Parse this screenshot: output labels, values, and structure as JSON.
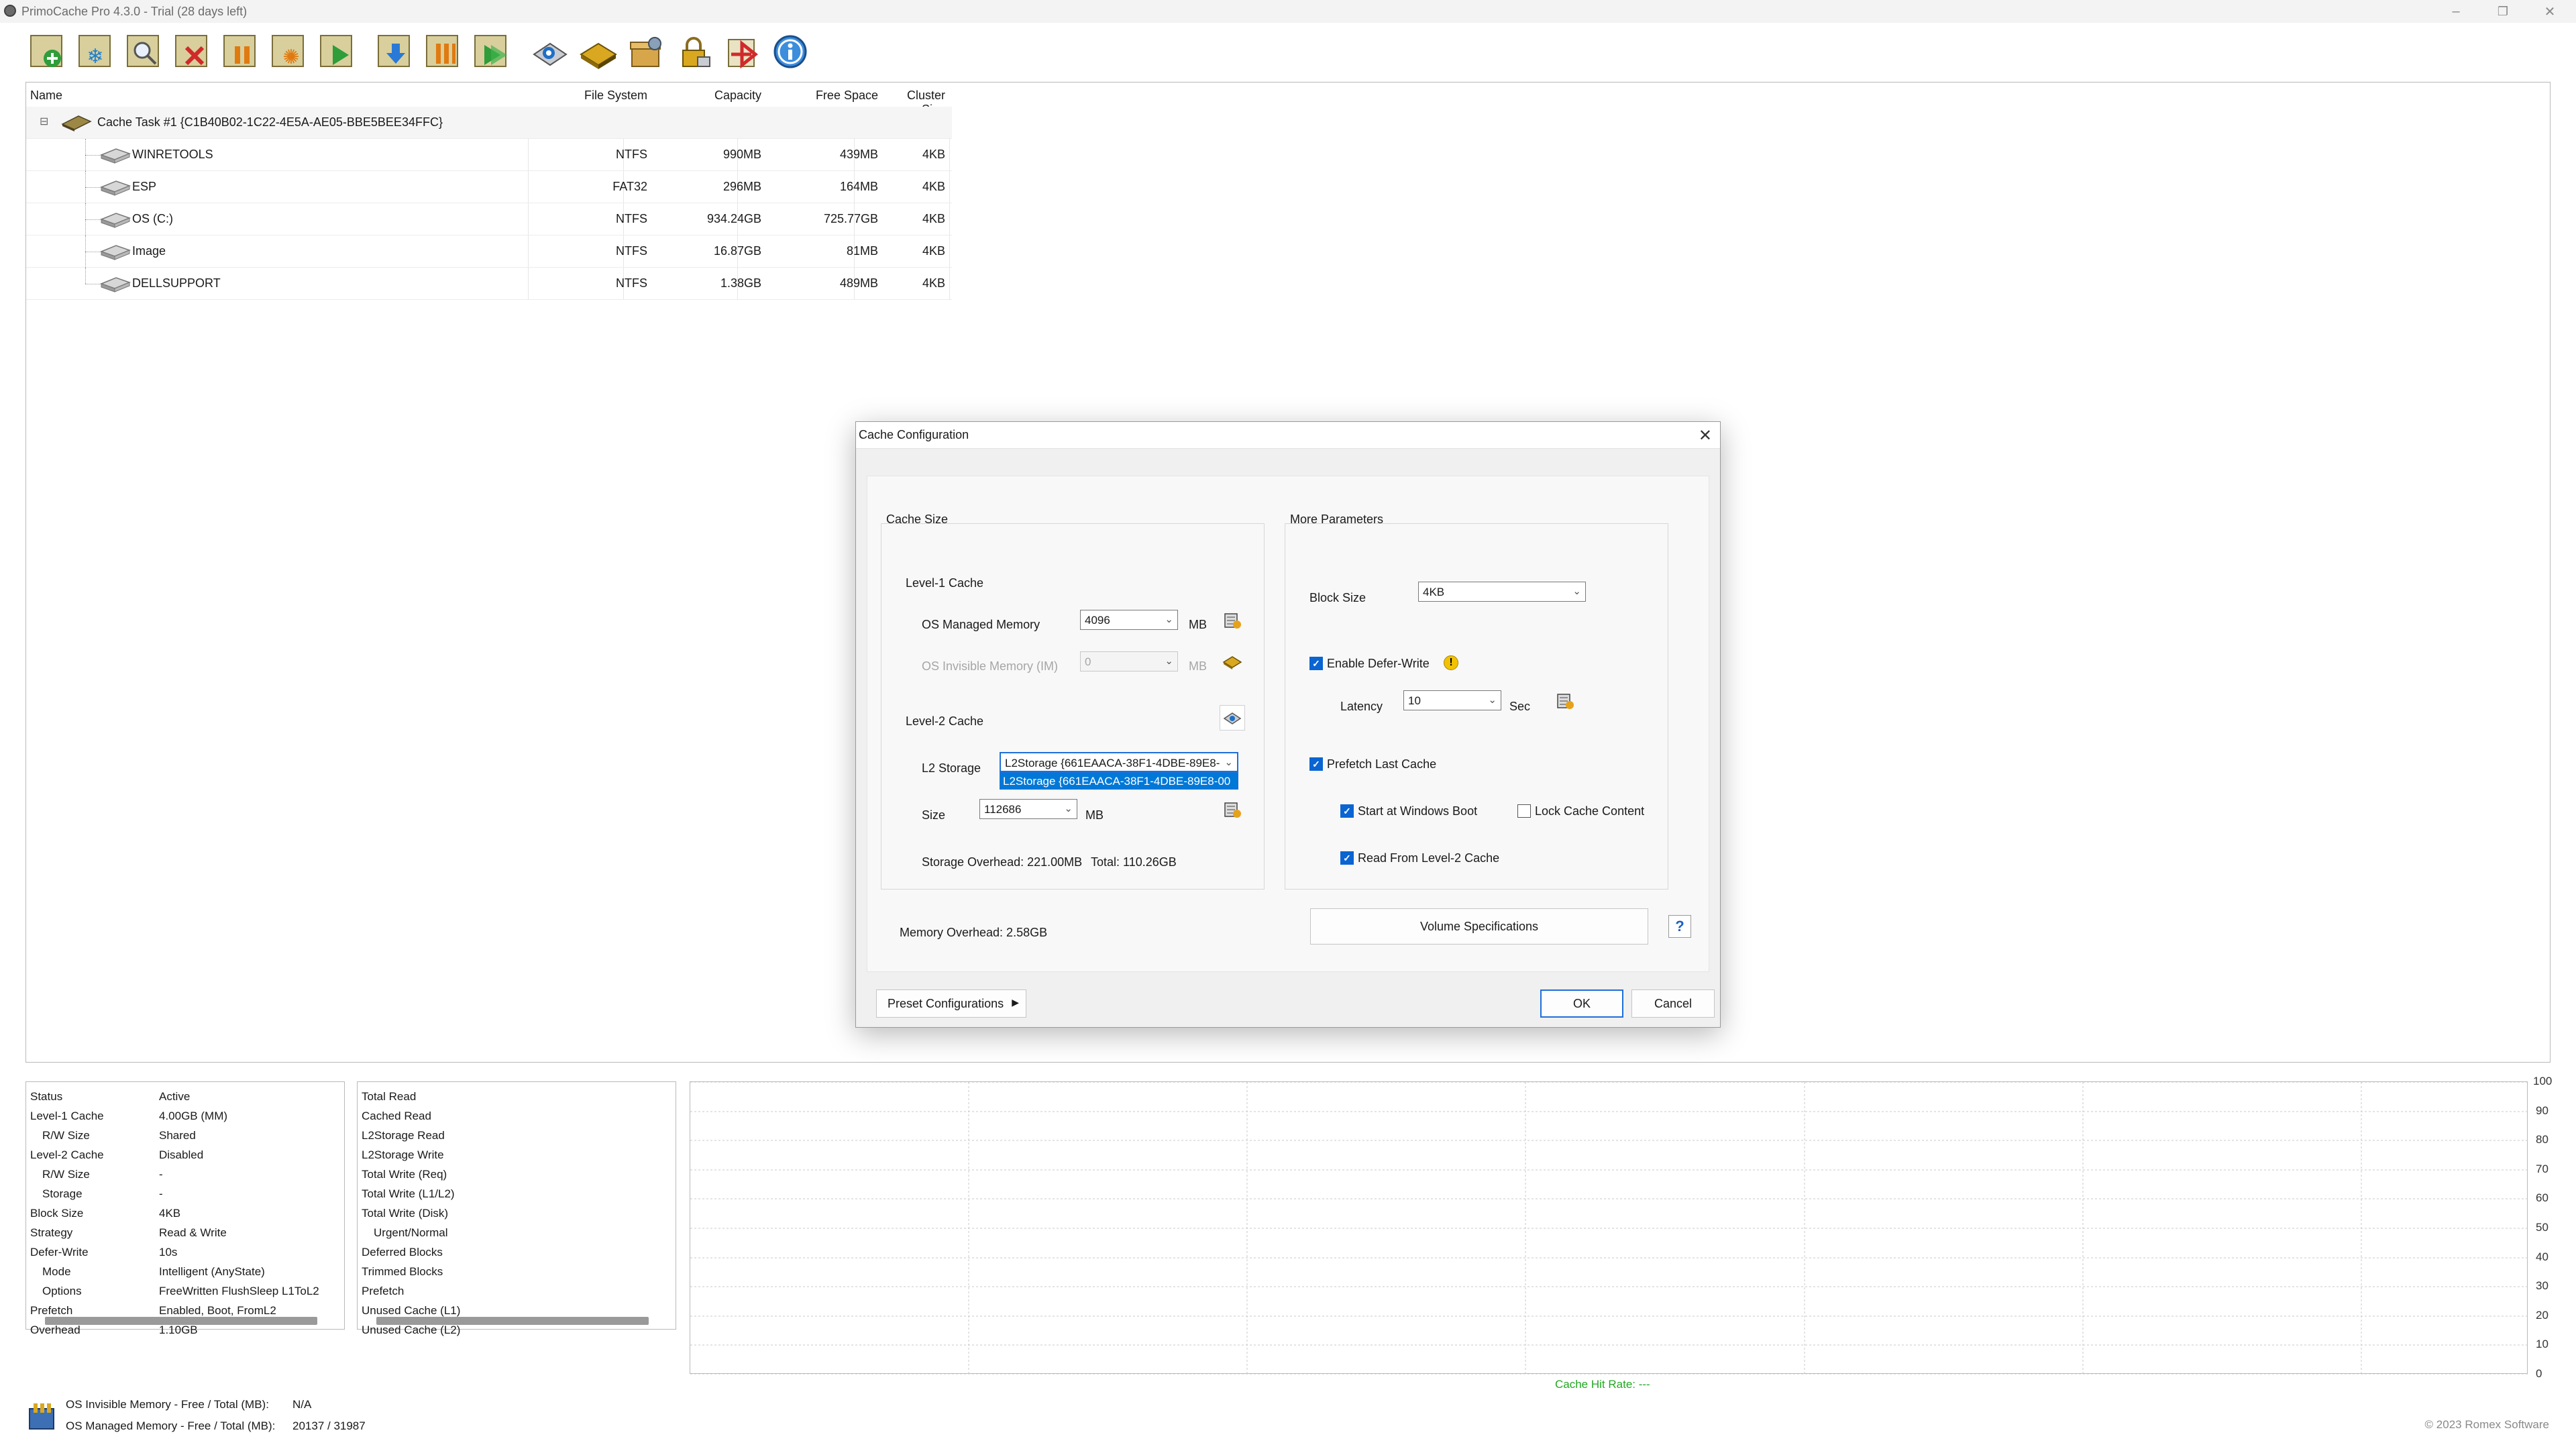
{
  "window": {
    "title": "PrimoCache Pro 4.3.0 - Trial (28 days left)"
  },
  "toolbar": {
    "icons": [
      "new-cache-task-icon",
      "defer-write-icon",
      "inspect-icon",
      "delete-cache-icon",
      "pause-icon",
      "flush-icon",
      "resume-icon",
      "store-icon",
      "pause-all-icon",
      "resume-all-icon",
      "settings-icon",
      "volume-icon",
      "package-icon",
      "lock-icon",
      "quit-icon",
      "about-icon"
    ]
  },
  "tree": {
    "columns": {
      "name": "Name",
      "fs": "File System",
      "capacity": "Capacity",
      "free": "Free Space",
      "cluster": "Cluster Size"
    },
    "task_label": "Cache Task #1 {C1B40B02-1C22-4E5A-AE05-BBE5BEE34FFC}",
    "task_toggle": "⊟",
    "volumes": [
      {
        "name": "WINRETOOLS",
        "fs": "NTFS",
        "capacity": "990MB",
        "free": "439MB",
        "cluster": "4KB"
      },
      {
        "name": "ESP",
        "fs": "FAT32",
        "capacity": "296MB",
        "free": "164MB",
        "cluster": "4KB"
      },
      {
        "name": "OS (C:)",
        "fs": "NTFS",
        "capacity": "934.24GB",
        "free": "725.77GB",
        "cluster": "4KB"
      },
      {
        "name": "Image",
        "fs": "NTFS",
        "capacity": "16.87GB",
        "free": "81MB",
        "cluster": "4KB"
      },
      {
        "name": "DELLSUPPORT",
        "fs": "NTFS",
        "capacity": "1.38GB",
        "free": "489MB",
        "cluster": "4KB"
      }
    ]
  },
  "status": {
    "rows": [
      {
        "k": "Status",
        "v": "Active",
        "indent": false
      },
      {
        "k": "Level-1 Cache",
        "v": "4.00GB (MM)",
        "indent": false
      },
      {
        "k": "R/W Size",
        "v": "Shared",
        "indent": true
      },
      {
        "k": "Level-2 Cache",
        "v": "Disabled",
        "indent": false
      },
      {
        "k": "R/W Size",
        "v": "-",
        "indent": true
      },
      {
        "k": "Storage",
        "v": "-",
        "indent": true
      },
      {
        "k": "Block Size",
        "v": "4KB",
        "indent": false
      },
      {
        "k": "Strategy",
        "v": "Read & Write",
        "indent": false
      },
      {
        "k": "Defer-Write",
        "v": "10s",
        "indent": false
      },
      {
        "k": "Mode",
        "v": "Intelligent (AnyState)",
        "indent": true
      },
      {
        "k": "Options",
        "v": "FreeWritten FlushSleep L1ToL2",
        "indent": true
      },
      {
        "k": "Prefetch",
        "v": "Enabled, Boot, FromL2",
        "indent": false
      },
      {
        "k": "Overhead",
        "v": "1.10GB",
        "indent": false
      }
    ]
  },
  "stats": {
    "rows": [
      {
        "k": "Total Read",
        "indent": false
      },
      {
        "k": "Cached Read",
        "indent": false
      },
      {
        "k": "L2Storage Read",
        "indent": false
      },
      {
        "k": "L2Storage Write",
        "indent": false
      },
      {
        "k": "Total Write (Req)",
        "indent": false
      },
      {
        "k": "Total Write (L1/L2)",
        "indent": false
      },
      {
        "k": "Total Write (Disk)",
        "indent": false
      },
      {
        "k": "Urgent/Normal",
        "indent": true
      },
      {
        "k": "Deferred Blocks",
        "indent": false
      },
      {
        "k": "Trimmed Blocks",
        "indent": false
      },
      {
        "k": "Prefetch",
        "indent": false
      },
      {
        "k": "Unused Cache (L1)",
        "indent": false
      },
      {
        "k": "Unused Cache (L2)",
        "indent": false
      }
    ]
  },
  "chart_data": {
    "type": "line",
    "title": "",
    "xlabel": "",
    "ylabel": "",
    "ylim": [
      0,
      100
    ],
    "yticks": [
      "100",
      "90",
      "80",
      "70",
      "60",
      "50",
      "40",
      "30",
      "20",
      "10",
      "0"
    ],
    "series": [],
    "grid": true,
    "caption": "Cache Hit Rate: ---",
    "caption_color": "#22a822"
  },
  "footer": {
    "invisible_label": "OS Invisible Memory - Free / Total (MB):",
    "invisible_value": "N/A",
    "managed_label": "OS Managed Memory - Free / Total (MB):",
    "managed_value": "20137 / 31987",
    "copyright": "© 2023 Romex Software"
  },
  "dialog": {
    "title": "Cache Configuration",
    "cache_size": {
      "legend": "Cache Size",
      "l1_label": "Level-1 Cache",
      "os_managed_label": "OS Managed Memory",
      "os_managed_value": "4096",
      "os_managed_unit": "MB",
      "os_invisible_label": "OS Invisible Memory (IM)",
      "os_invisible_value": "0",
      "os_invisible_unit": "MB",
      "l2_label": "Level-2 Cache",
      "l2_storage_label": "L2 Storage",
      "l2_storage_value": "L2Storage {661EAACA-38F1-4DBE-89E8-",
      "l2_storage_option": "L2Storage {661EAACA-38F1-4DBE-89E8-00",
      "size_label": "Size",
      "size_value": "112686",
      "size_unit": "MB",
      "storage_overhead": "Storage Overhead: 221.00MB",
      "total": "Total: 110.26GB"
    },
    "more": {
      "legend": "More Parameters",
      "block_size_label": "Block Size",
      "block_size_value": "4KB",
      "enable_defer_label": "Enable Defer-Write",
      "enable_defer_checked": true,
      "latency_label": "Latency",
      "latency_value": "10",
      "latency_unit": "Sec",
      "prefetch_label": "Prefetch Last Cache",
      "prefetch_checked": true,
      "start_boot_label": "Start at Windows Boot",
      "start_boot_checked": true,
      "lock_label": "Lock Cache Content",
      "lock_checked": false,
      "read_l2_label": "Read From Level-2 Cache",
      "read_l2_checked": true
    },
    "memory_overhead": "Memory Overhead: 2.58GB",
    "volume_specs": "Volume Specifications",
    "help": "?",
    "preset": "Preset Configurations",
    "ok": "OK",
    "cancel": "Cancel"
  }
}
